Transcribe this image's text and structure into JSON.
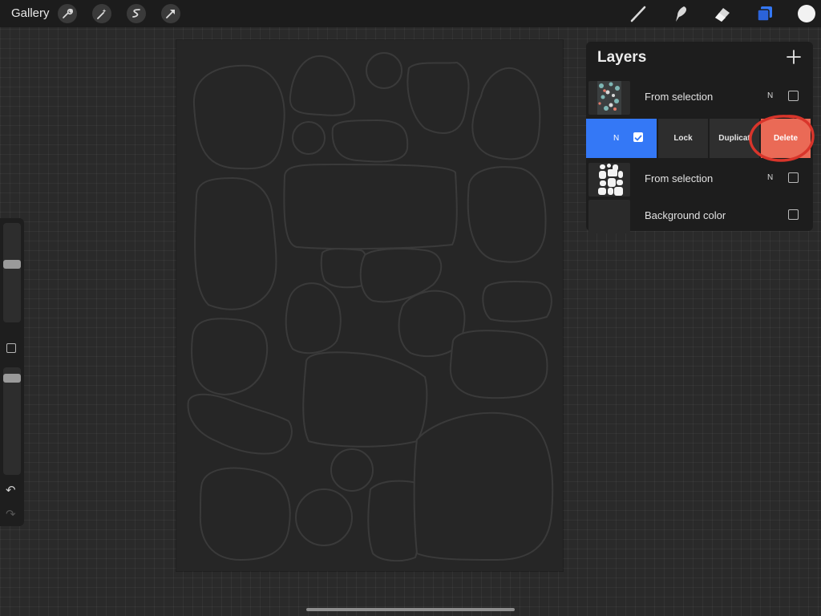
{
  "topbar": {
    "gallery_label": "Gallery",
    "left_tools": [
      "wrench-icon",
      "magic-wand-icon",
      "selection-icon",
      "arrow-icon"
    ],
    "right_tools": [
      "brush-icon",
      "smudge-icon",
      "eraser-icon",
      "layers-icon",
      "color-icon"
    ],
    "active_color": "#f2f2f2",
    "layers_icon_color": "#3478f6"
  },
  "layers": {
    "title": "Layers",
    "rows": [
      {
        "name": "From selection",
        "blend": "N",
        "visible": false
      },
      {
        "name": "",
        "blend": "N",
        "visible": true,
        "selected": true
      },
      {
        "name": "From selection",
        "blend": "N",
        "visible": false
      },
      {
        "name": "Background color",
        "visible": false
      }
    ],
    "swipe_actions": {
      "lock": "Lock",
      "duplicate": "Duplicat",
      "delete": "Delete"
    },
    "selected_color": "#3478f6",
    "delete_color": "#ea6a56",
    "highlight_circle_color": "#d9352b"
  }
}
